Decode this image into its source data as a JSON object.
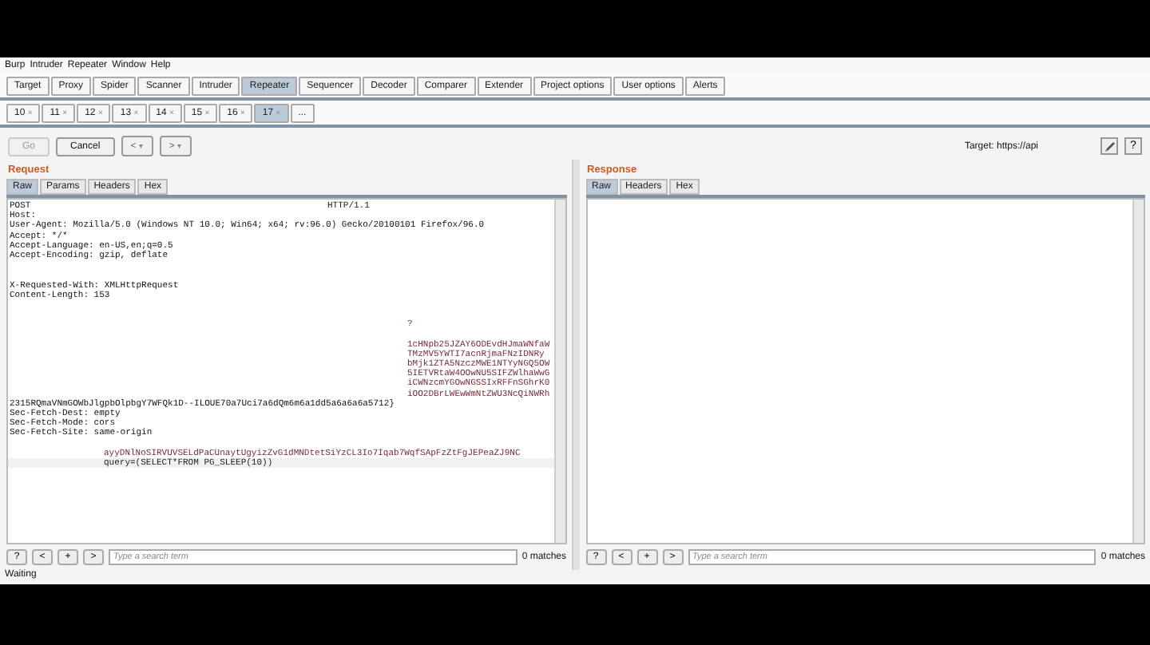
{
  "menu": [
    "Burp",
    "Intruder",
    "Repeater",
    "Window",
    "Help"
  ],
  "tabs": [
    {
      "label": "Target",
      "selected": false
    },
    {
      "label": "Proxy",
      "selected": false
    },
    {
      "label": "Spider",
      "selected": false
    },
    {
      "label": "Scanner",
      "selected": false
    },
    {
      "label": "Intruder",
      "selected": false
    },
    {
      "label": "Repeater",
      "selected": true
    },
    {
      "label": "Sequencer",
      "selected": false
    },
    {
      "label": "Decoder",
      "selected": false
    },
    {
      "label": "Comparer",
      "selected": false
    },
    {
      "label": "Extender",
      "selected": false
    },
    {
      "label": "Project options",
      "selected": false
    },
    {
      "label": "User options",
      "selected": false
    },
    {
      "label": "Alerts",
      "selected": false
    }
  ],
  "subtabs": [
    {
      "label": "10",
      "close": "×",
      "selected": false
    },
    {
      "label": "11",
      "close": "×",
      "selected": false
    },
    {
      "label": "12",
      "close": "×",
      "selected": false
    },
    {
      "label": "13",
      "close": "×",
      "selected": false
    },
    {
      "label": "14",
      "close": "×",
      "selected": false
    },
    {
      "label": "15",
      "close": "×",
      "selected": false
    },
    {
      "label": "16",
      "close": "×",
      "selected": false
    },
    {
      "label": "17",
      "close": "×",
      "selected": true
    }
  ],
  "subtab_more": "...",
  "toolbar": {
    "go": {
      "label": "Go",
      "disabled": true
    },
    "cancel": {
      "label": "Cancel",
      "disabled": false
    },
    "back": "<",
    "forward": ">",
    "caret": "▾",
    "target": "Target: https://api",
    "help": "?"
  },
  "request": {
    "title": "Request",
    "tabs": [
      {
        "label": "Raw",
        "selected": true
      },
      {
        "label": "Params",
        "selected": false
      },
      {
        "label": "Headers",
        "selected": false
      },
      {
        "label": "Hex",
        "selected": false
      }
    ],
    "lines": [
      {
        "text": "POST",
        "tail": "HTTP/1.1",
        "highlight": false
      },
      {
        "text": "Host:",
        "highlight": false
      },
      {
        "text": "User-Agent: Mozilla/5.0 (Windows NT 10.0; Win64; x64; rv:96.0) Gecko/20100101 Firefox/96.0",
        "highlight": false
      },
      {
        "text": "Accept: */*",
        "highlight": false
      },
      {
        "text": "Accept-Language: en-US,en;q=0.5",
        "highlight": false
      },
      {
        "text": "Accept-Encoding: gzip, deflate",
        "highlight": false
      },
      {
        "highlight": false
      },
      {
        "highlight": false
      },
      {
        "text": "X-Requested-With: XMLHttpRequest",
        "highlight": false
      },
      {
        "text": "Content-Length: 153",
        "highlight": false
      },
      {
        "highlight": false
      },
      {
        "highlight": false
      },
      {
        "tail": "?",
        "highlight": false
      },
      {
        "highlight": false
      },
      {
        "tail": "1cHNpb25JZAY6ODEvdHJmaWNfaW",
        "highlight": false
      },
      {
        "tail": "TMzMV5YWTI7acnRjmaFNzIDNRy",
        "highlight": false
      },
      {
        "tail": "bMjk1ZTA5NzczMWE1NTYyNGQ5OW",
        "highlight": false
      },
      {
        "tail": "5IETVRtaW4OOwNU5SIFZWlhaWwG",
        "highlight": false
      },
      {
        "tail": "iCWNzcmYGOwNGSSIxRFFnSGhrK0",
        "highlight": false
      },
      {
        "tail": "iOO2DBrLWEwWmNtZWU3NcQiNWRh",
        "highlight": false
      },
      {
        "text": "2315RQmaVNmGOWbJlgpbOlpbgY7WFQk1D--ILOUE70a7Uci7a6dQm6m6a1dd5a6a6a6a5712}",
        "highlight": false
      },
      {
        "text": "Sec-Fetch-Dest: empty",
        "highlight": false
      },
      {
        "text": "Sec-Fetch-Mode: cors",
        "highlight": false
      },
      {
        "text": "Sec-Fetch-Site: same-origin",
        "highlight": false
      },
      {
        "highlight": false
      },
      {
        "tail": "ayyDNlNoSIRVUVSELdPaCUnaytUgyizZvG1dMNDtetSiYzCL3Io7Iqab7WqfSApFzZtFgJEPeaZJ9NC",
        "highlight": false
      },
      {
        "tail": "query=(SELECT*FROM PG_SLEEP(10))",
        "highlight": true
      }
    ],
    "search": {
      "placeholder": "Type a search term",
      "matches": "0 matches"
    }
  },
  "response": {
    "title": "Response",
    "tabs": [
      {
        "label": "Raw",
        "selected": true
      },
      {
        "label": "Headers",
        "selected": false
      },
      {
        "label": "Hex",
        "selected": false
      }
    ],
    "search": {
      "placeholder": "Type a search term",
      "matches": "0 matches"
    }
  },
  "search_buttons": [
    "?",
    "<",
    "+",
    ">"
  ],
  "status": "Waiting"
}
